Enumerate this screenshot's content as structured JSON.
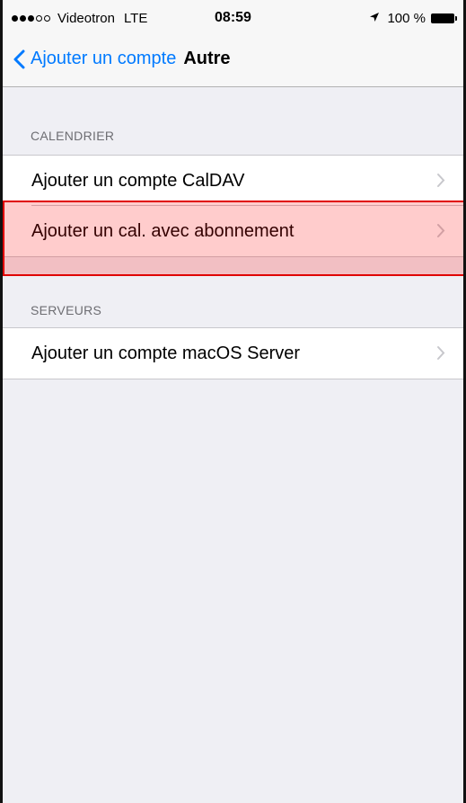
{
  "status_bar": {
    "carrier": "Videotron",
    "network": "LTE",
    "time": "08:59",
    "battery": "100 %"
  },
  "nav": {
    "back_label": "Ajouter un compte",
    "title": "Autre"
  },
  "sections": {
    "calendar": {
      "header": "CALENDRIER",
      "items": [
        {
          "label": "Ajouter un compte CalDAV"
        },
        {
          "label": "Ajouter un cal. avec abonnement"
        }
      ]
    },
    "servers": {
      "header": "SERVEURS",
      "items": [
        {
          "label": "Ajouter un compte macOS Server"
        }
      ]
    }
  },
  "colors": {
    "accent": "#007aff",
    "highlight": "#e00000",
    "background": "#efeff4"
  }
}
